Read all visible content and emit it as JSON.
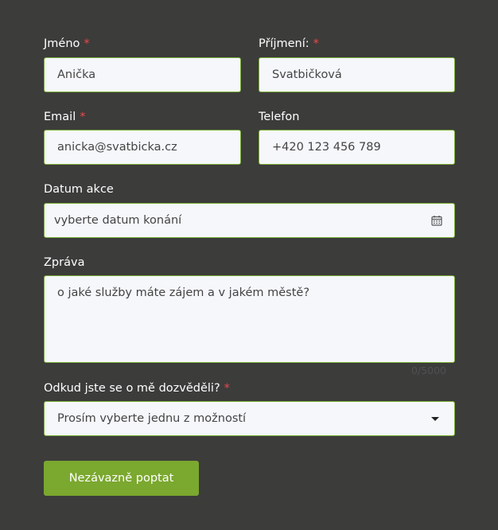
{
  "form": {
    "first_name": {
      "label": "Jméno",
      "required_mark": "*",
      "value": "Anička"
    },
    "last_name": {
      "label": "Příjmení:",
      "required_mark": "*",
      "value": "Svatbičková"
    },
    "email": {
      "label": "Email",
      "required_mark": "*",
      "value": "anicka@svatbicka.cz"
    },
    "phone": {
      "label": "Telefon",
      "value": "+420 123 456 789"
    },
    "event_date": {
      "label": "Datum akce",
      "placeholder": "vyberte datum konání",
      "icon": "calendar-icon"
    },
    "message": {
      "label": "Zpráva",
      "placeholder": "o jaké služby máte zájem a v jakém městě?",
      "counter": "0/5000"
    },
    "source": {
      "label": "Odkud jste se o mě dozvěděli?",
      "required_mark": "*",
      "selected": "Prosím vyberte jednu z možností",
      "icon": "caret-down-icon"
    },
    "submit_label": "Nezávazně poptat"
  },
  "colors": {
    "background": "#3c3c3b",
    "field_background": "#f5f7fb",
    "field_border": "#7bae36",
    "accent": "#7ba82f",
    "required": "#e94b4b"
  }
}
